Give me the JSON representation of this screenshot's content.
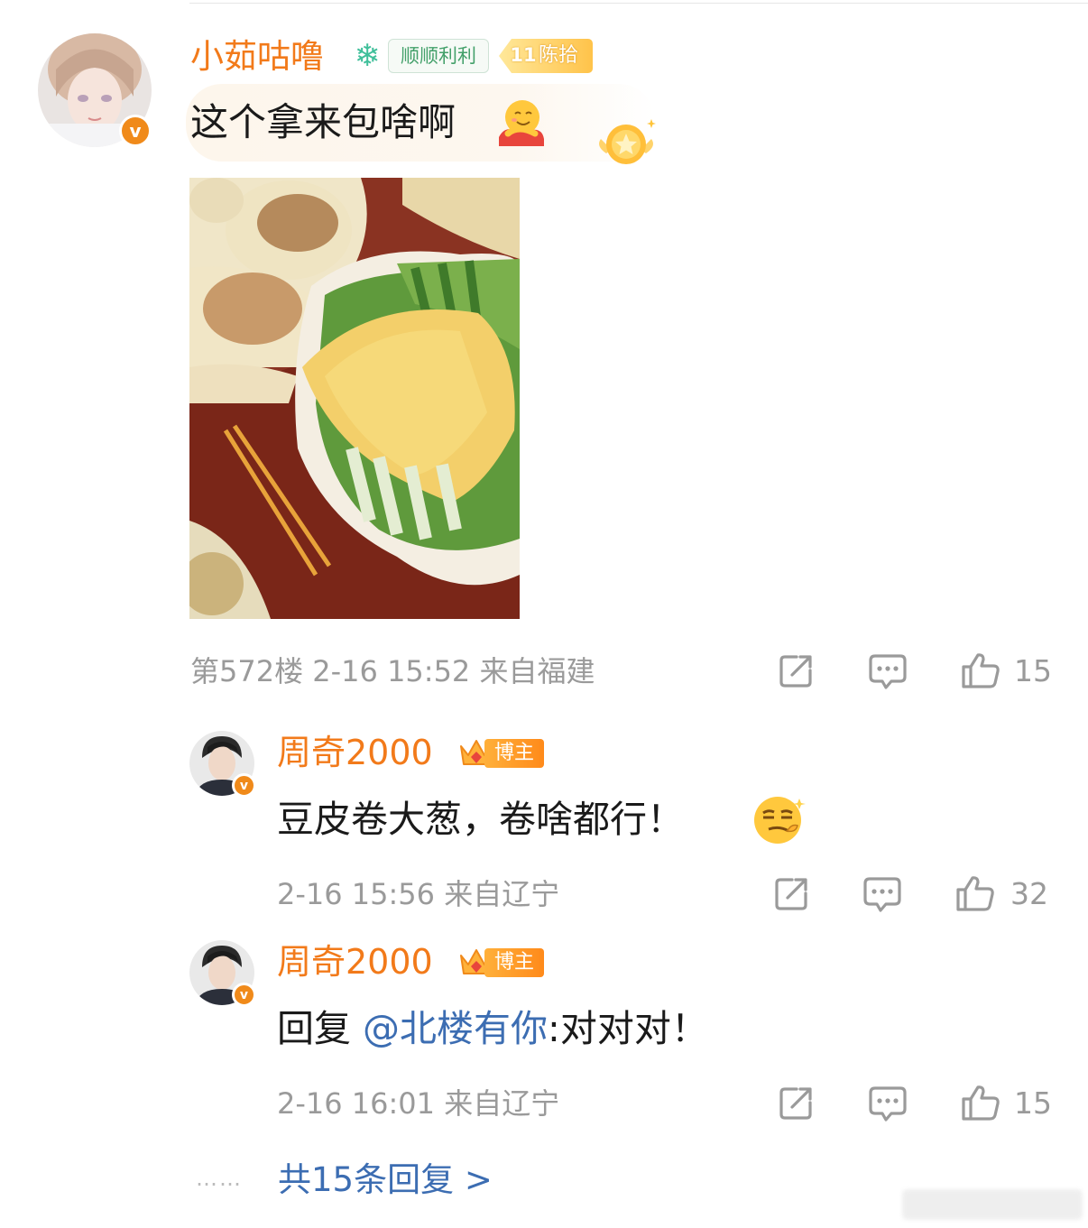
{
  "main_comment": {
    "username": "小茹咕噜",
    "fan_badge": "顺顺利利",
    "level": {
      "number": "11",
      "label": "陈拾"
    },
    "text": "这个拿来包啥啊",
    "floor": "第572楼",
    "time": "2-16 15:52",
    "location": "来自福建",
    "likes": "15"
  },
  "replies": [
    {
      "username": "周奇2000",
      "role_badge": "博主",
      "text": "豆皮卷大葱，卷啥都行！",
      "time": "2-16 15:56",
      "location": "来自辽宁",
      "likes": "32"
    },
    {
      "username": "周奇2000",
      "role_badge": "博主",
      "reply_prefix": "回复 ",
      "mention": "@北楼有你",
      "text": ":对对对！",
      "time": "2-16 16:01",
      "location": "来自辽宁",
      "likes": "15"
    }
  ],
  "more_replies": {
    "dots": "……",
    "label": "共15条回复 >"
  },
  "verified_mark": "v",
  "colors": {
    "username": "#f27a1a",
    "link": "#3c6db2",
    "meta": "#9a9a9a",
    "verified": "#f08a1a"
  },
  "icons": [
    "repost-icon",
    "comment-icon",
    "like-icon",
    "verified-icon",
    "snowflake-icon",
    "crown-icon"
  ]
}
